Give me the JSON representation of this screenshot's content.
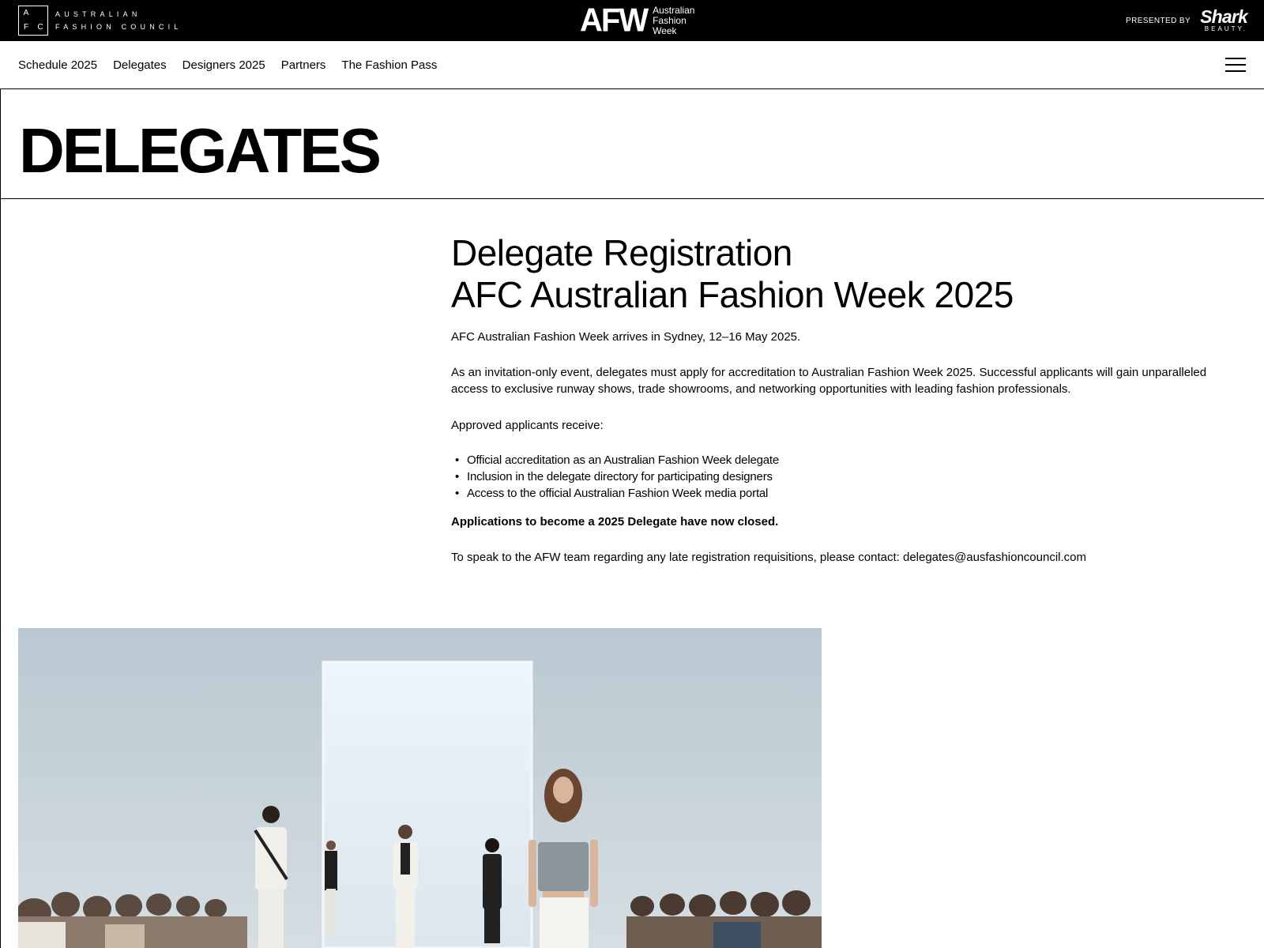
{
  "topbar": {
    "afc_logo": {
      "letters": [
        "A",
        "",
        "F",
        "C"
      ],
      "line1": "AUSTRALIAN",
      "line2": "FASHION COUNCIL"
    },
    "afw_logo": {
      "mark": "AFW",
      "line1": "Australian",
      "line2": "Fashion",
      "line3": "Week"
    },
    "presented_by": "PRESENTED BY",
    "sponsor": {
      "name": "Shark",
      "sub": "BEAUTY."
    }
  },
  "nav": {
    "items": [
      "Schedule 2025",
      "Delegates",
      "Designers 2025",
      "Partners",
      "The Fashion Pass"
    ],
    "menu_icon": "hamburger-menu-icon"
  },
  "page": {
    "title": "DELEGATES"
  },
  "main": {
    "heading_line1": "Delegate Registration",
    "heading_line2": "AFC Australian Fashion Week 2025",
    "intro": "AFC Australian Fashion Week arrives in Sydney, 12–16 May 2025.",
    "description": "As an invitation-only event, delegates must apply for accreditation to Australian Fashion Week 2025. Successful applicants will gain unparalleled access to exclusive runway shows, trade showrooms, and networking opportunities with leading fashion professionals.",
    "approved_label": "Approved applicants receive:",
    "benefits": [
      "Official accreditation as an Australian Fashion Week delegate",
      "Inclusion in the delegate directory for participating designers",
      "Access to the official Australian Fashion Week media portal"
    ],
    "closed_notice": "Applications to become a 2025 Delegate have now closed.",
    "contact": "To speak to the AFW team regarding any late registration requisitions, please contact: delegates@ausfashioncouncil.com"
  },
  "colors": {
    "topbar_bg": "#000000",
    "text": "#000000",
    "background": "#ffffff"
  }
}
